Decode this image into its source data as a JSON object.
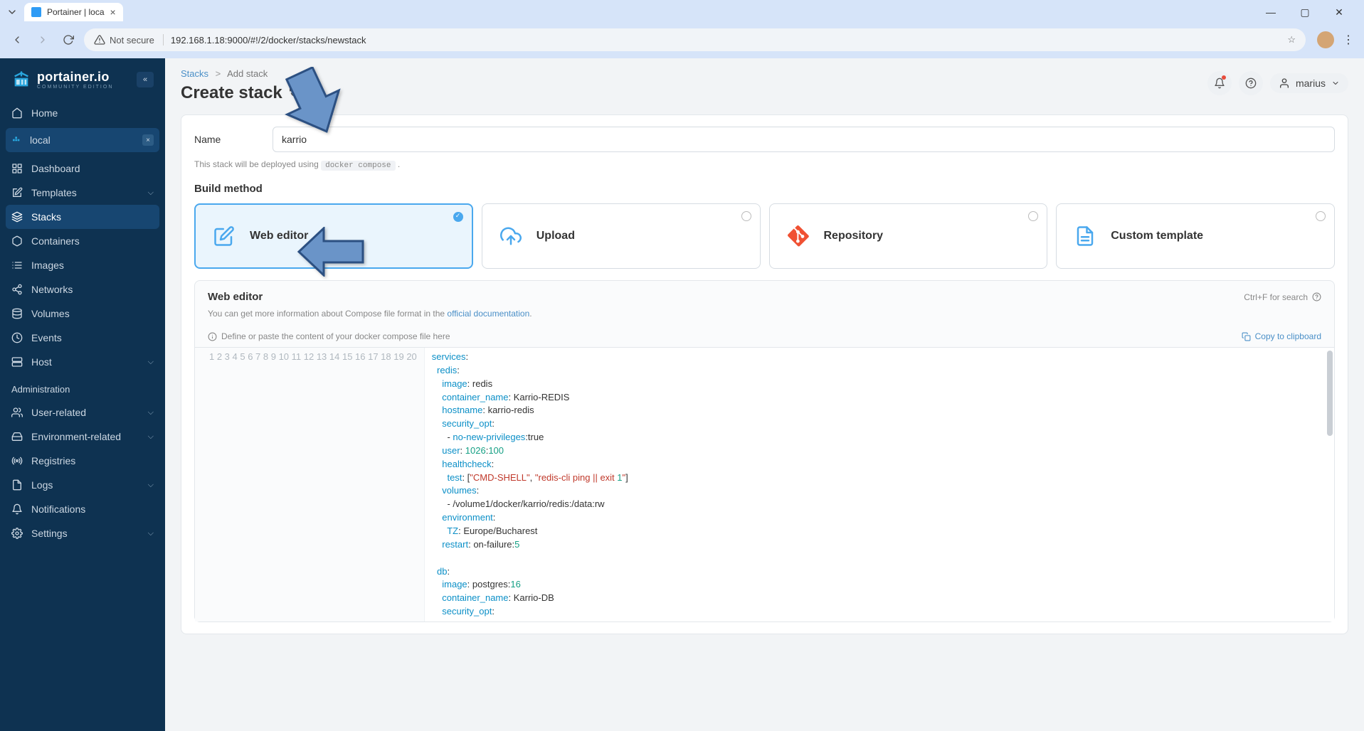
{
  "browser": {
    "tab_title": "Portainer | loca",
    "not_secure": "Not secure",
    "url": "192.168.1.18:9000/#!/2/docker/stacks/newstack"
  },
  "logo": {
    "name": "portainer.io",
    "edition": "COMMUNITY EDITION"
  },
  "user": {
    "name": "marius"
  },
  "nav": {
    "home": "Home",
    "env": "local",
    "dashboard": "Dashboard",
    "templates": "Templates",
    "stacks": "Stacks",
    "containers": "Containers",
    "images": "Images",
    "networks": "Networks",
    "volumes": "Volumes",
    "events": "Events",
    "host": "Host",
    "admin_label": "Administration",
    "user_related": "User-related",
    "env_related": "Environment-related",
    "registries": "Registries",
    "logs": "Logs",
    "notifications": "Notifications",
    "settings": "Settings"
  },
  "breadcrumb": {
    "root": "Stacks",
    "current": "Add stack"
  },
  "page_title": "Create stack",
  "form": {
    "name_label": "Name",
    "name_value": "karrio",
    "deploy_hint_pre": "This stack will be deployed using ",
    "deploy_hint_code": "docker compose",
    "deploy_hint_post": "."
  },
  "build": {
    "section": "Build method",
    "web_editor": "Web editor",
    "upload": "Upload",
    "repository": "Repository",
    "custom": "Custom template"
  },
  "editor": {
    "panel_title": "Web editor",
    "search_hint": "Ctrl+F for search",
    "desc_pre": "You can get more information about Compose file format in the ",
    "desc_link": "official documentation",
    "desc_post": ".",
    "placeholder": "Define or paste the content of your docker compose file here",
    "copy": "Copy to clipboard"
  },
  "code_lines": [
    "services:",
    "  redis:",
    "    image: redis",
    "    container_name: Karrio-REDIS",
    "    hostname: karrio-redis",
    "    security_opt:",
    "      - no-new-privileges:true",
    "    user: 1026:100",
    "    healthcheck:",
    "      test: [\"CMD-SHELL\", \"redis-cli ping || exit 1\"]",
    "    volumes:",
    "      - /volume1/docker/karrio/redis:/data:rw",
    "    environment:",
    "      TZ: Europe/Bucharest",
    "    restart: on-failure:5",
    "",
    "  db:",
    "    image: postgres:16",
    "    container_name: Karrio-DB",
    "    security_opt:"
  ]
}
